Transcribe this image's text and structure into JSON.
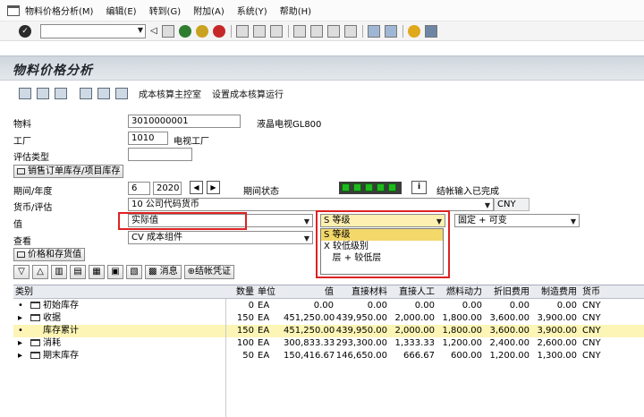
{
  "menubar": [
    "物料价格分析(M)",
    "编辑(E)",
    "转到(G)",
    "附加(A)",
    "系统(Y)",
    "帮助(H)"
  ],
  "title": "物料价格分析",
  "app_toolbar": {
    "cost_cockpit": "成本核算主控室",
    "set_costing_run": "设置成本核算运行"
  },
  "form": {
    "material_label": "物料",
    "material_value": "3010000001",
    "material_desc": "液晶电视GL800",
    "plant_label": "工厂",
    "plant_value": "1010",
    "plant_desc": "电视工厂",
    "valtype_label": "评估类型",
    "valtype_value": "",
    "sales_order_btn": "销售订单库存/项目库存",
    "period_label": "期间/年度",
    "period_value": "6",
    "year_value": "2020",
    "period_status_label": "期间状态",
    "period_status_text": "结帐输入已完成",
    "currency_label": "货币/评估",
    "currency_value": "10 公司代码货币",
    "currency_code": "CNY",
    "value_label": "值",
    "value_select": "实际值",
    "level_select": "S 等级",
    "fixvar_select": "固定 + 可变",
    "view_label": "查看",
    "view_select": "CV 成本组件",
    "price_stock_btn": "价格和存货值"
  },
  "dropdown_options": [
    "S 等级",
    "X 较低级别",
    "   层 + 较低层"
  ],
  "grid_toolbar": {
    "messages": "消息",
    "post_closing": "结帐凭证"
  },
  "table": {
    "headers": [
      "类别",
      "数量",
      "单位",
      "值",
      "直接材料",
      "直接人工",
      "燃料动力",
      "折旧费用",
      "制造费用",
      "货币"
    ],
    "rows": [
      {
        "cat": "初始库存",
        "qty": "0",
        "unit": "EA",
        "val": "0.00",
        "dm": "0.00",
        "dl": "0.00",
        "fuel": "0.00",
        "dep": "0.00",
        "mfg": "0.00",
        "cur": "CNY"
      },
      {
        "cat": "收据",
        "qty": "150",
        "unit": "EA",
        "val": "451,250.00",
        "dm": "439,950.00",
        "dl": "2,000.00",
        "fuel": "1,800.00",
        "dep": "3,600.00",
        "mfg": "3,900.00",
        "cur": "CNY"
      },
      {
        "cat": "库存累计",
        "qty": "150",
        "unit": "EA",
        "val": "451,250.00",
        "dm": "439,950.00",
        "dl": "2,000.00",
        "fuel": "1,800.00",
        "dep": "3,600.00",
        "mfg": "3,900.00",
        "cur": "CNY"
      },
      {
        "cat": "消耗",
        "qty": "100",
        "unit": "EA",
        "val": "300,833.33",
        "dm": "293,300.00",
        "dl": "1,333.33",
        "fuel": "1,200.00",
        "dep": "2,400.00",
        "mfg": "2,600.00",
        "cur": "CNY"
      },
      {
        "cat": "期末库存",
        "qty": "50",
        "unit": "EA",
        "val": "150,416.67",
        "dm": "146,650.00",
        "dl": "666.67",
        "fuel": "600.00",
        "dep": "1,200.00",
        "mfg": "1,300.00",
        "cur": "CNY"
      }
    ]
  }
}
